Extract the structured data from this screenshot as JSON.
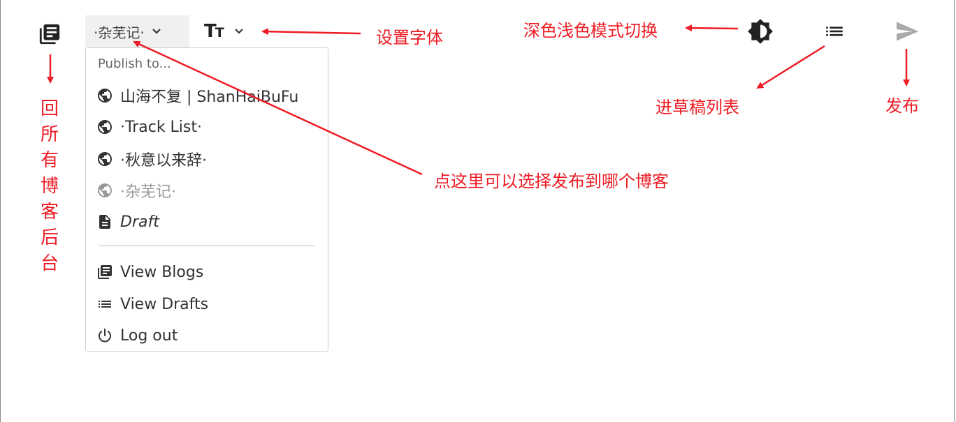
{
  "toolbar": {
    "blogs_icon": "library-books-icon",
    "selected_blog": "·杂芜记·",
    "font_label_big": "T",
    "font_label_small": "T",
    "theme_icon": "brightness-contrast-icon",
    "drafts_icon": "list-icon",
    "publish_icon": "send-icon"
  },
  "dropdown": {
    "header": "Publish to...",
    "items": [
      {
        "icon": "globe-icon",
        "label": "山海不复 | ShanHaiBuFu"
      },
      {
        "icon": "globe-icon",
        "label": "·Track List·"
      },
      {
        "icon": "globe-icon",
        "label": "·秋意以来辞·"
      },
      {
        "icon": "globe-icon",
        "label": "·杂芜记·",
        "state": "selected-disabled"
      },
      {
        "icon": "document-icon",
        "label": "Draft"
      }
    ],
    "actions": [
      {
        "icon": "library-books-icon",
        "label": "View Blogs"
      },
      {
        "icon": "list-icon",
        "label": "View Drafts"
      },
      {
        "icon": "power-icon",
        "label": "Log out"
      }
    ]
  },
  "annotations": {
    "back_to_blogs": "回所有博客后台",
    "set_font": "设置字体",
    "theme_toggle": "深色浅色模式切换",
    "draft_list": "进草稿列表",
    "publish": "发布",
    "choose_blog": "点这里可以选择发布到哪个博客"
  },
  "colors": {
    "annotation": "#ee1c24",
    "icon_dark": "#222222",
    "icon_muted": "#aaaaaa",
    "select_bg": "#f0f0f0"
  }
}
